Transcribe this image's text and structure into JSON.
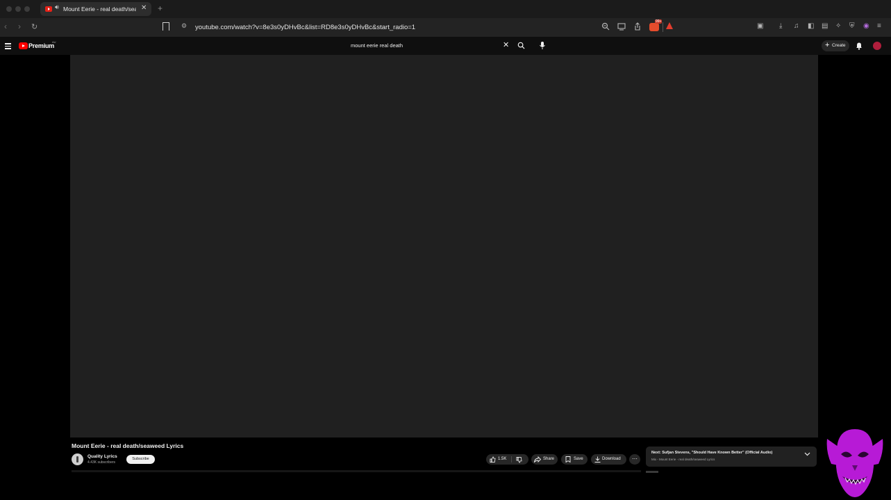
{
  "browser": {
    "tab": {
      "title": "Mount Eerie - real death/seaweed Lyrics"
    },
    "address": {
      "url": "youtube.com/watch?v=8e3s0yDHvBc&list=RD8e3s0yDHvBc&start_radio=1"
    },
    "brave_shield_count": "99+"
  },
  "youtube": {
    "logo_text": "Premium",
    "logo_region": "AU",
    "search": {
      "query": "mount eerie real death"
    },
    "create_label": "Create"
  },
  "video": {
    "title": "Mount Eerie - real death/seaweed Lyrics",
    "channel": {
      "name": "Quality Lyrics",
      "subscribers": "4.43K subscribers"
    },
    "subscribe_label": "Subscribe",
    "actions": {
      "like_count": "1.5K",
      "share_label": "Share",
      "save_label": "Save",
      "download_label": "Download"
    },
    "next": {
      "title": "Next: Sufjan Stevens, \"Should Have Known Better\" (Official Audio)",
      "subtitle": "Mix - Mount Eerie - real death/seaweed Lyrics"
    }
  },
  "colors": {
    "background": "#000000",
    "masthead": "#0f0f0f",
    "player": "#202020",
    "youtube_red": "#ff0000",
    "overlay_magenta": "#b71ad6"
  },
  "icons": [
    "audio-icon",
    "close-icon",
    "new-tab-icon",
    "back-icon",
    "forward-icon",
    "reload-icon",
    "bookmark-icon",
    "site-settings-icon",
    "zoom-icon",
    "cast-icon",
    "share-page-icon",
    "brave-shields-icon",
    "rewards-icon",
    "menu-icon",
    "search-icon",
    "mic-icon",
    "bell-icon",
    "thumbs-up-icon",
    "thumbs-down-icon",
    "share-icon",
    "save-icon",
    "download-icon",
    "more-icon",
    "chevron-down-icon"
  ]
}
